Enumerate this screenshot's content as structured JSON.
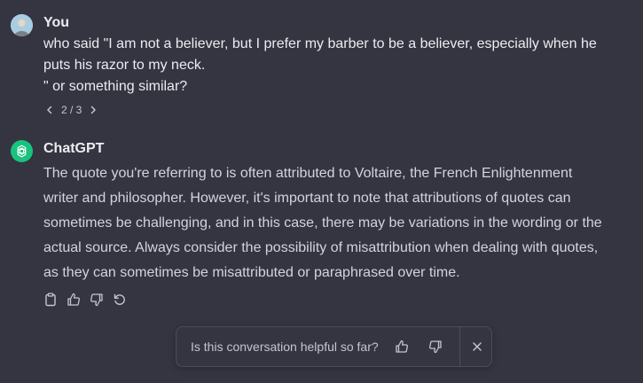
{
  "conversation": {
    "user_message": {
      "author": "You",
      "text": "who said \"I am not a believer, but I prefer my barber to be a believer, especially when he\nputs his razor to my neck.\n\" or something similar?",
      "pager": {
        "label": "2 / 3"
      }
    },
    "assistant_message": {
      "author": "ChatGPT",
      "text": "The quote you're referring to is often attributed to Voltaire, the French Enlightenment writer and philosopher. However, it's important to note that attributions of quotes can sometimes be challenging, and in this case, there may be variations in the wording or the actual source. Always consider the possibility of misattribution when dealing with quotes, as they can sometimes be misattributed or paraphrased over time.",
      "actions": [
        "copy-icon",
        "thumbs-up-icon",
        "thumbs-down-icon",
        "regenerate-icon"
      ]
    }
  },
  "feedback": {
    "question": "Is this conversation helpful so far?",
    "icons": [
      "thumbs-up-icon",
      "thumbs-down-icon",
      "close-icon"
    ]
  },
  "colors": {
    "background": "#343541",
    "text": "#ececf1",
    "secondary_text": "#c5c5d2",
    "gpt_avatar": "#19c37d",
    "border": "#4d4d56"
  }
}
